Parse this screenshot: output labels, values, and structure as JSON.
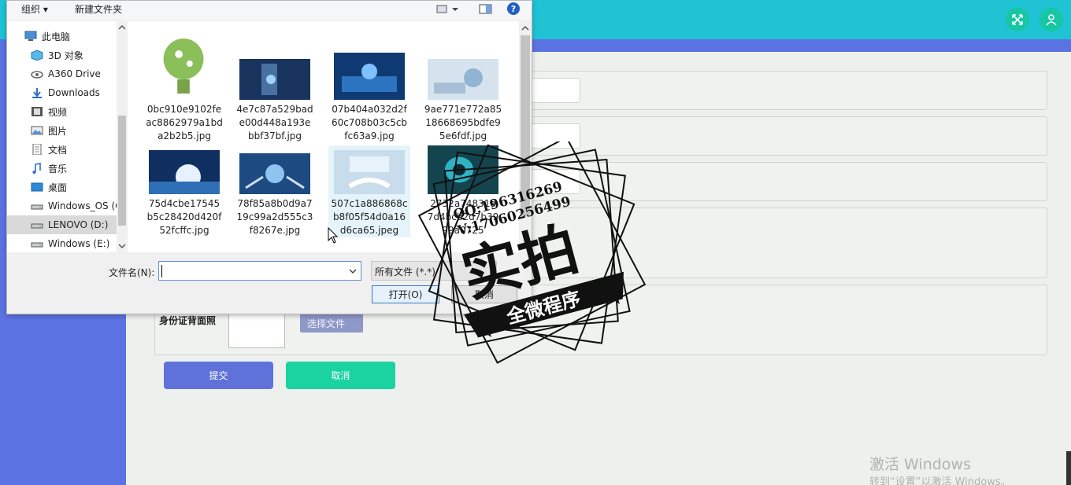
{
  "dialog": {
    "toolbar": {
      "organize": "组织 ▾",
      "new_folder": "新建文件夹",
      "help": "?"
    },
    "nav_items": [
      {
        "label": "此电脑",
        "icon": "computer-icon"
      },
      {
        "label": "3D 对象",
        "icon": "3d-objects-icon"
      },
      {
        "label": "A360 Drive",
        "icon": "cloud-drive-icon"
      },
      {
        "label": "Downloads",
        "icon": "download-arrow-icon"
      },
      {
        "label": "视频",
        "icon": "video-icon"
      },
      {
        "label": "图片",
        "icon": "pictures-icon"
      },
      {
        "label": "文档",
        "icon": "documents-icon"
      },
      {
        "label": "音乐",
        "icon": "music-icon"
      },
      {
        "label": "桌面",
        "icon": "desktop-icon"
      },
      {
        "label": "Windows_OS (C",
        "icon": "drive-icon"
      },
      {
        "label": "LENOVO (D:)",
        "icon": "drive-icon"
      },
      {
        "label": "Windows (E:)",
        "icon": "drive-icon"
      }
    ],
    "files": [
      {
        "name": "0bc910e9102feac8862979a1bda2b2b5.jpg",
        "lines": [
          "0bc910e9102fe",
          "ac8862979a1bd",
          "a2b2b5.jpg"
        ]
      },
      {
        "name": "4e7c87a529bade00d448a193ebbf37bf.jpg",
        "lines": [
          "4e7c87a529bad",
          "e00d448a193e",
          "bbf37bf.jpg"
        ]
      },
      {
        "name": "07b404a032d2f60c708b03c5cbfc63a9.jpg",
        "lines": [
          "07b404a032d2f",
          "60c708b03c5cb",
          "fc63a9.jpg"
        ]
      },
      {
        "name": "9ae771e772a8518668695bdfe95e6fdf.jpg",
        "lines": [
          "9ae771e772a85",
          "18668695bdfe9",
          "5e6fdf.jpg"
        ]
      },
      {
        "name": "75d4cbe17545b5c28420d420f52fcffc.jpg",
        "lines": [
          "75d4cbe17545",
          "b5c28420d420f",
          "52fcffc.jpg"
        ]
      },
      {
        "name": "78f85a8b0d9a719c99a2d555c3f8267e.jpg",
        "lines": [
          "78f85a8b0d9a7",
          "19c99a2d555c3",
          "f8267e.jpg"
        ]
      },
      {
        "name": "507c1a886868cb8f05f54d0a16d6ca65.jpeg",
        "lines": [
          "507c1a886868c",
          "b8f05f54d0a16",
          "d6ca65.jpeg"
        ]
      },
      {
        "name": "2732a74831a7d4bcb2d7b3999a0725",
        "lines": [
          "2732a74831a",
          "7d4bcb2d7b39",
          "99a0725"
        ]
      }
    ],
    "filename_label": "文件名(N):",
    "filename_value": "",
    "filter_label": "所有文件 (*.*)",
    "open_label": "打开(O)",
    "cancel_label": "取消"
  },
  "form": {
    "back_id_label": "身份证背面照",
    "choose_file_label": "选择文件",
    "submit_label": "提交",
    "cancel_label": "取消"
  },
  "stamp": {
    "line1": "QQ:196316269",
    "line2": "V:17060256499",
    "main": "实拍",
    "banner": "全微程序"
  },
  "os_watermark": {
    "line1": "激活 Windows",
    "line2": "转到“设置”以激活 Windows。"
  },
  "colors": {
    "topbar": "#1fc3d4",
    "sidebar": "#5b73e2",
    "submit": "#5f72da",
    "cancel": "#1bd3a0"
  }
}
